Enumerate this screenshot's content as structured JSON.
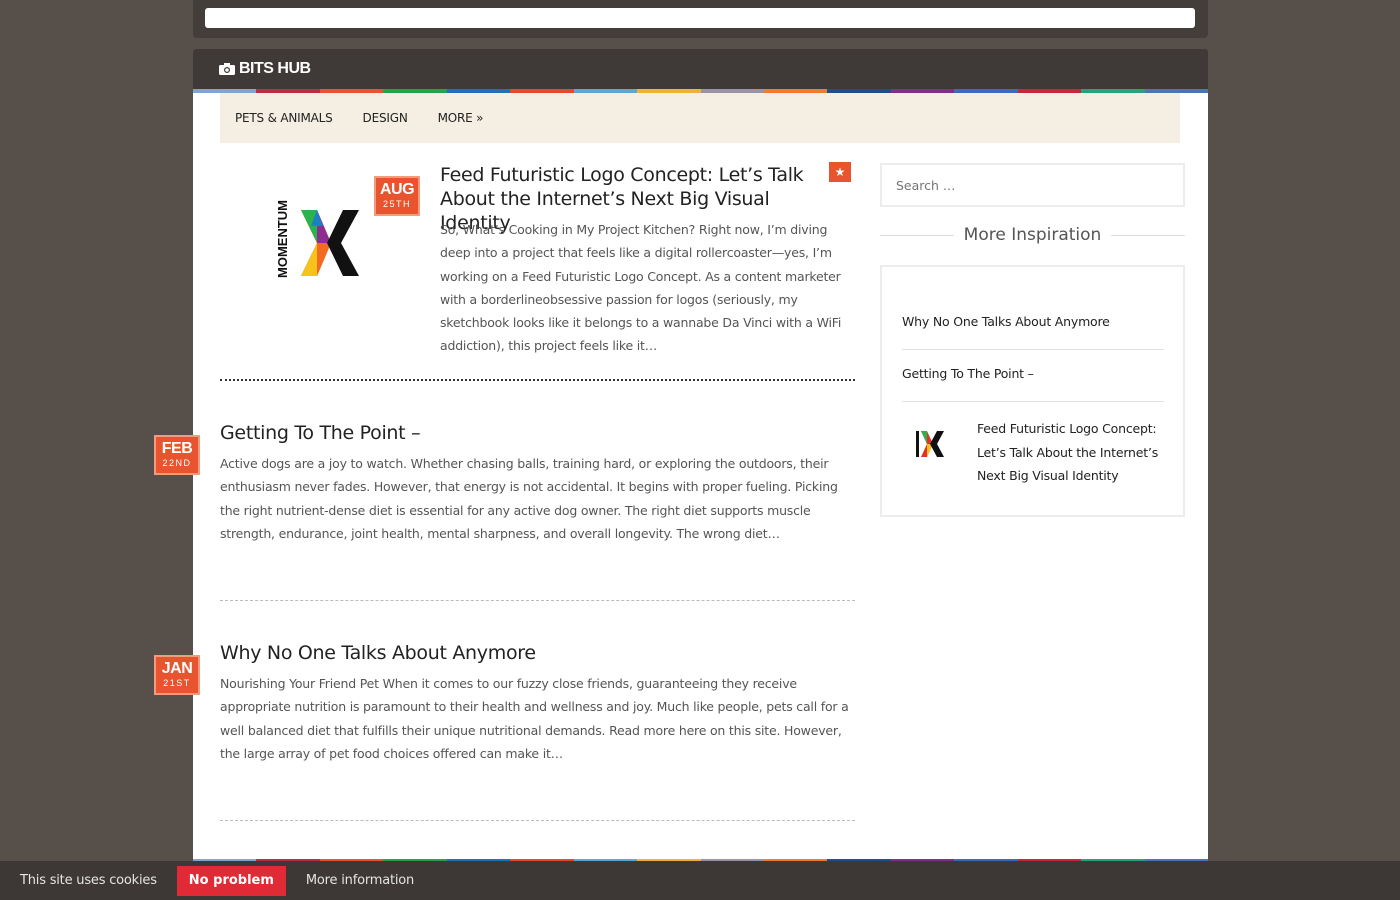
{
  "site": {
    "name": "BITS HUB"
  },
  "nav": {
    "items": [
      "PETS & ANIMALS",
      "DESIGN",
      "MORE »"
    ]
  },
  "posts": [
    {
      "month": "AUG",
      "day": "25TH",
      "title": "Feed Futuristic Logo Concept: Let’s Talk About the Internet’s Next Big Visual Identity",
      "excerpt": "So, What’s Cooking in My Project Kitchen? Right now, I’m diving deep into a project that feels like a digital rollercoaster—yes, I’m working on a Feed Futuristic Logo Concept. As a content marketer with a borderlineobsessive passion for logos (seriously, my sketchbook looks like it belongs to a wannabe Da Vinci with a WiFi addiction), this project feels like it…",
      "thumb_text": "MOMENTUM"
    },
    {
      "month": "FEB",
      "day": "22ND",
      "title": "Getting To The Point –",
      "excerpt": "Active dogs are a joy to watch. Whether chasing balls, training hard, or exploring the outdoors, their enthusiasm never fades. However, that energy is not accidental. It begins with proper fueling. Picking the right nutrient-dense diet is essential for any active dog owner. The right diet supports muscle strength, endurance, joint health, mental sharpness, and overall longevity. The wrong diet…"
    },
    {
      "month": "JAN",
      "day": "21ST",
      "title": "Why No One Talks About Anymore",
      "excerpt": "Nourishing Your Friend Pet When it comes to our fuzzy close friends, guaranteeing they receive appropriate nutrition is paramount to their health and wellness and joy. Much like people, pets call for a well balanced diet that fulfills their unique nutritional demands. Read more here on this site. However, the large array of pet food choices offered can make it…"
    }
  ],
  "sidebar": {
    "search_placeholder": "Search …",
    "widget_title": "More Inspiration",
    "items": [
      "Why No One Talks About Anymore",
      "Getting To The Point –",
      "Feed Futuristic Logo Concept: Let’s Talk About the Internet’s Next Big Visual Identity"
    ]
  },
  "cookie": {
    "message": "This site uses cookies",
    "accept": "No problem",
    "more": "More information"
  },
  "colors": {
    "accent": "#e8542d",
    "stripe": [
      "#7fa4d6",
      "#b53045",
      "#e8542d",
      "#27a14b",
      "#1f72b8",
      "#e14a2a",
      "#5aa7d8",
      "#f2b134",
      "#9b93a8",
      "#f07d2b",
      "#1d4e8e",
      "#812e8c",
      "#3a6bbd",
      "#c4283a",
      "#2aa17e",
      "#4b74b9"
    ]
  }
}
